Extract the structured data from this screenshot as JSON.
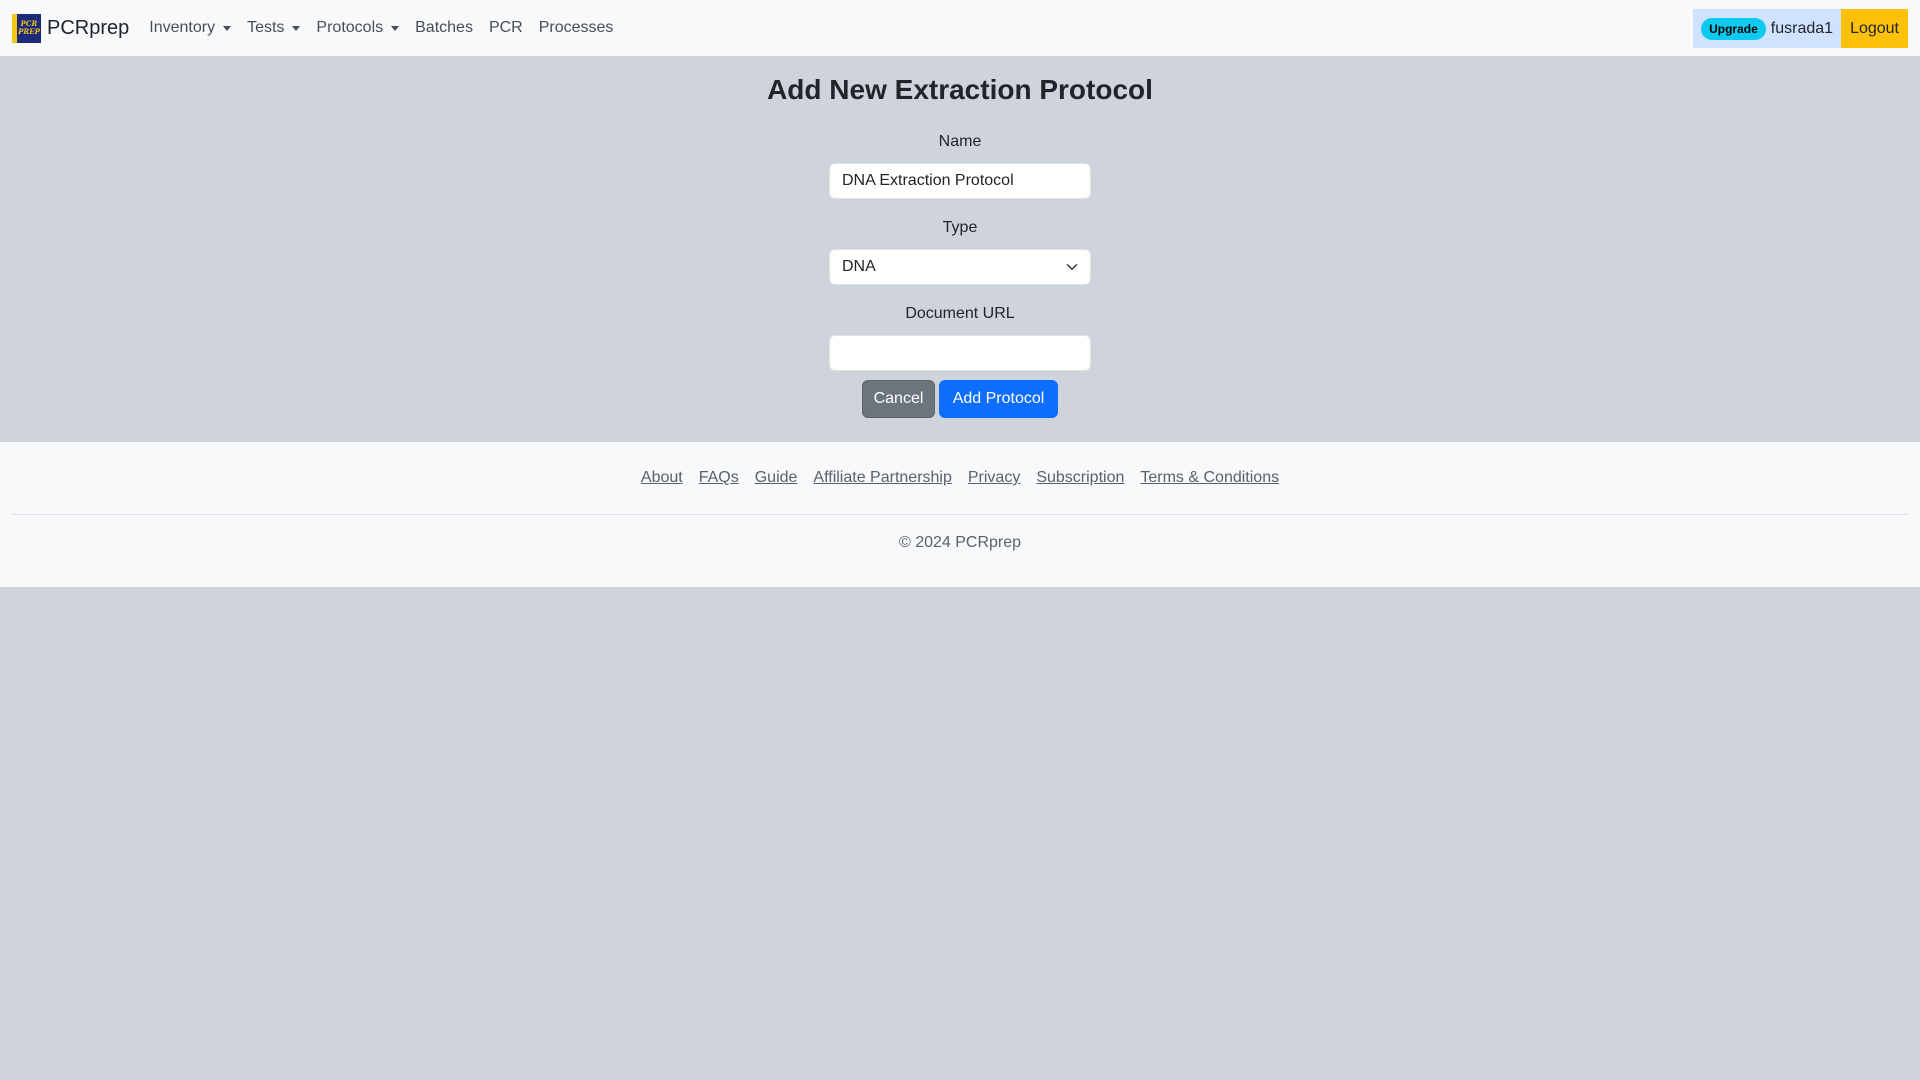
{
  "navbar": {
    "brand": "PCRprep",
    "logo_text": [
      "PCR",
      "PREP"
    ],
    "items": [
      {
        "label": "Inventory",
        "dropdown": true
      },
      {
        "label": "Tests",
        "dropdown": true
      },
      {
        "label": "Protocols",
        "dropdown": true
      },
      {
        "label": "Batches",
        "dropdown": false
      },
      {
        "label": "PCR",
        "dropdown": false
      },
      {
        "label": "Processes",
        "dropdown": false
      }
    ],
    "upgrade_badge": "Upgrade",
    "username": "fusrada1",
    "logout": "Logout"
  },
  "form": {
    "title": "Add New Extraction Protocol",
    "name_label": "Name",
    "name_value": "DNA Extraction Protocol",
    "type_label": "Type",
    "type_value": "DNA",
    "doc_label": "Document URL",
    "doc_value": "",
    "cancel_label": "Cancel",
    "submit_label": "Add Protocol"
  },
  "footer": {
    "links": [
      "About",
      "FAQs",
      "Guide",
      "Affiliate Partnership",
      "Privacy",
      "Subscription",
      "Terms & Conditions"
    ],
    "copyright": "© 2024 PCRprep"
  },
  "colors": {
    "background": "#cfd4dc",
    "navbar": "#f8f9fa",
    "primary": "#0d6efd",
    "secondary": "#6c757d",
    "warning": "#ffc107",
    "info": "#0dcaf0",
    "user_box": "#cfe2ff"
  },
  "icons": {
    "select": "chevron-down-icon",
    "dropdown": "caret-down-icon"
  }
}
